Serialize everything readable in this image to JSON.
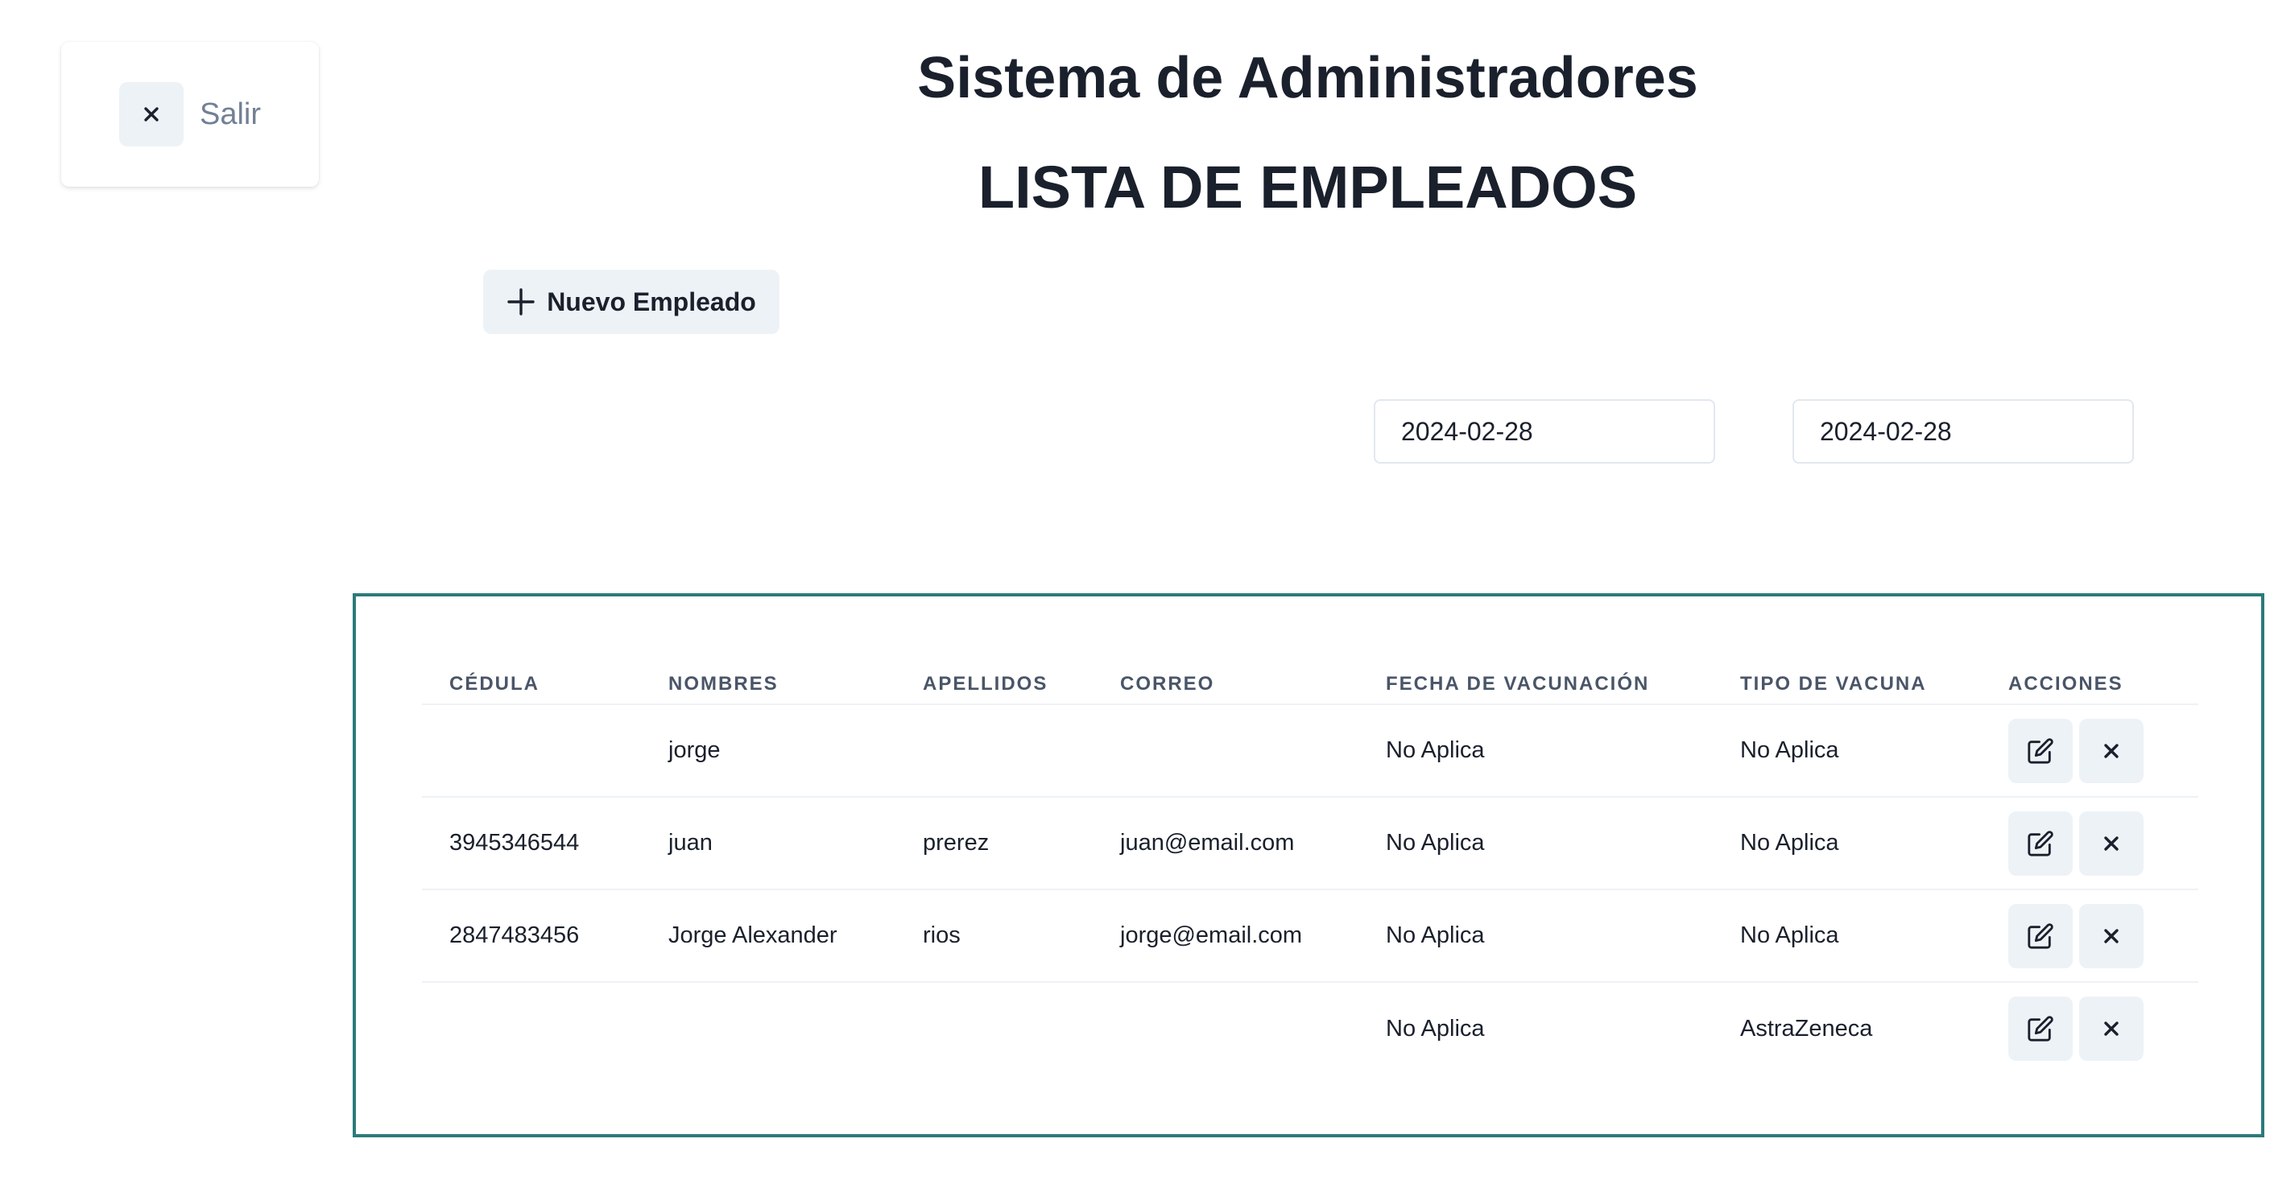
{
  "logout": {
    "label": "Salir",
    "icon": "close-icon"
  },
  "header": {
    "app_title": "Sistema de Administradores",
    "list_title": "LISTA DE EMPLEADOS"
  },
  "toolbar": {
    "new_employee_label": "Nuevo Empleado",
    "new_employee_icon": "plus-icon"
  },
  "filters": {
    "date_from": "2024-02-28",
    "date_to": "2024-02-28"
  },
  "table": {
    "columns": [
      "CÉDULA",
      "NOMBRES",
      "APELLIDOS",
      "CORREO",
      "FECHA DE VACUNACIÓN",
      "TIPO DE VACUNA",
      "ACCIONES"
    ],
    "rows": [
      {
        "cedula": "",
        "nombres": "jorge",
        "apellidos": "",
        "correo": "",
        "fecha": "No Aplica",
        "tipo": "No Aplica"
      },
      {
        "cedula": "3945346544",
        "nombres": "juan",
        "apellidos": "prerez",
        "correo": "juan@email.com",
        "fecha": "No Aplica",
        "tipo": "No Aplica"
      },
      {
        "cedula": "2847483456",
        "nombres": "Jorge Alexander",
        "apellidos": "rios",
        "correo": "jorge@email.com",
        "fecha": "No Aplica",
        "tipo": "No Aplica"
      },
      {
        "cedula": "",
        "nombres": "",
        "apellidos": "",
        "correo": "",
        "fecha": "No Aplica",
        "tipo": "AstraZeneca"
      }
    ],
    "action_icons": [
      "edit-icon",
      "close-icon"
    ]
  },
  "colors": {
    "border_accent": "#2c7a7b",
    "button_bg": "#edf2f7",
    "text_primary": "#1a202c",
    "text_muted": "#718096"
  }
}
